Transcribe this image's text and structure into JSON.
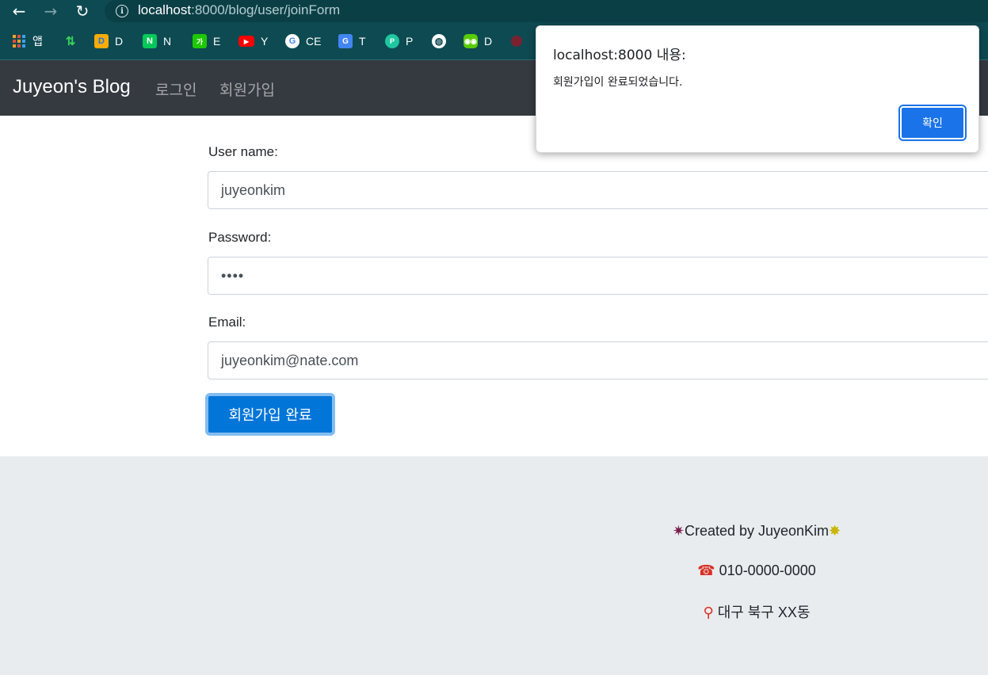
{
  "browser": {
    "url_host": "localhost",
    "url_rest": ":8000/blog/user/joinForm",
    "back_icon": "arrow-left",
    "forward_icon": "arrow-right",
    "reload_icon": "reload",
    "info_icon": "info"
  },
  "bookmarks": [
    {
      "label": "앱",
      "icon": "apps-grid"
    },
    {
      "label": "",
      "icon": "arrows-icon"
    },
    {
      "label": "D",
      "icon": "d-logo",
      "color": "#f9ab00"
    },
    {
      "label": "N",
      "icon": "naver-n",
      "color": "#03c75a"
    },
    {
      "label": "E",
      "icon": "ga-logo",
      "color": "#1ec800"
    },
    {
      "label": "Y",
      "icon": "youtube",
      "color": "#ff0000"
    },
    {
      "label": "CE",
      "icon": "google-g",
      "color": "#4285f4"
    },
    {
      "label": "T",
      "icon": "google-translate",
      "color": "#4285f4"
    },
    {
      "label": "P",
      "icon": "papago",
      "color": "#1ec7a0"
    },
    {
      "label": "",
      "icon": "globe",
      "color": "#ffffff"
    },
    {
      "label": "D",
      "icon": "duolingo",
      "color": "#58cc02"
    }
  ],
  "navbar": {
    "brand": "Juyeon's Blog",
    "links": [
      "로그인",
      "회원가입"
    ]
  },
  "form": {
    "username_label": "User name:",
    "username_value": "juyeonkim",
    "password_label": "Password:",
    "password_value": "••••",
    "email_label": "Email:",
    "email_value": "juyeonkim@nate.com",
    "submit_label": "회원가입 완료"
  },
  "footer": {
    "created": "Created by JuyeonKim",
    "phone": "010-0000-0000",
    "address": "대구 북구 XX동"
  },
  "dialog": {
    "title": "localhost:8000 내용:",
    "message": "회원가입이 완료되었습니다.",
    "ok_label": "확인"
  },
  "colors": {
    "navbar_bg": "#343a40",
    "primary": "#0275d8",
    "footer_bg": "#e9ecef",
    "chrome_bg": "#0e4a52",
    "dialog_button": "#1a73e8"
  }
}
